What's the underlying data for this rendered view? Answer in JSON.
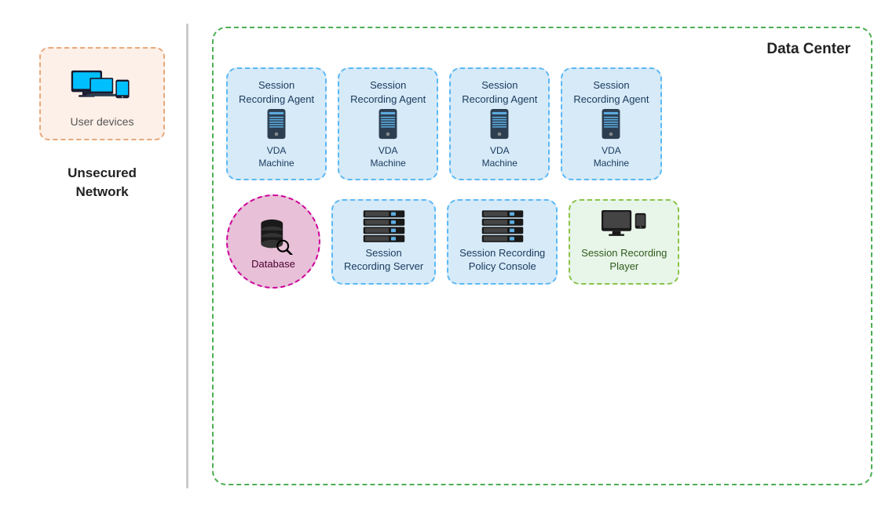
{
  "left": {
    "unsecured_label": "Unsecured\nNetwork",
    "user_devices_label": "User devices"
  },
  "right": {
    "data_center_title": "Data Center",
    "agents": [
      {
        "title": "Session\nRecording Agent",
        "sublabel": "VDA\nMachine"
      },
      {
        "title": "Session\nRecording Agent",
        "sublabel": "VDA\nMachine"
      },
      {
        "title": "Session\nRecording Agent",
        "sublabel": "VDA\nMachine"
      },
      {
        "title": "Session\nRecording Agent",
        "sublabel": "VDA\nMachine"
      }
    ],
    "database_label": "Database",
    "session_recording_server_label": "Session\nRecording Server",
    "session_recording_policy_label": "Session Recording\nPolicy Console",
    "session_recording_player_label": "Session Recording\nPlayer"
  }
}
